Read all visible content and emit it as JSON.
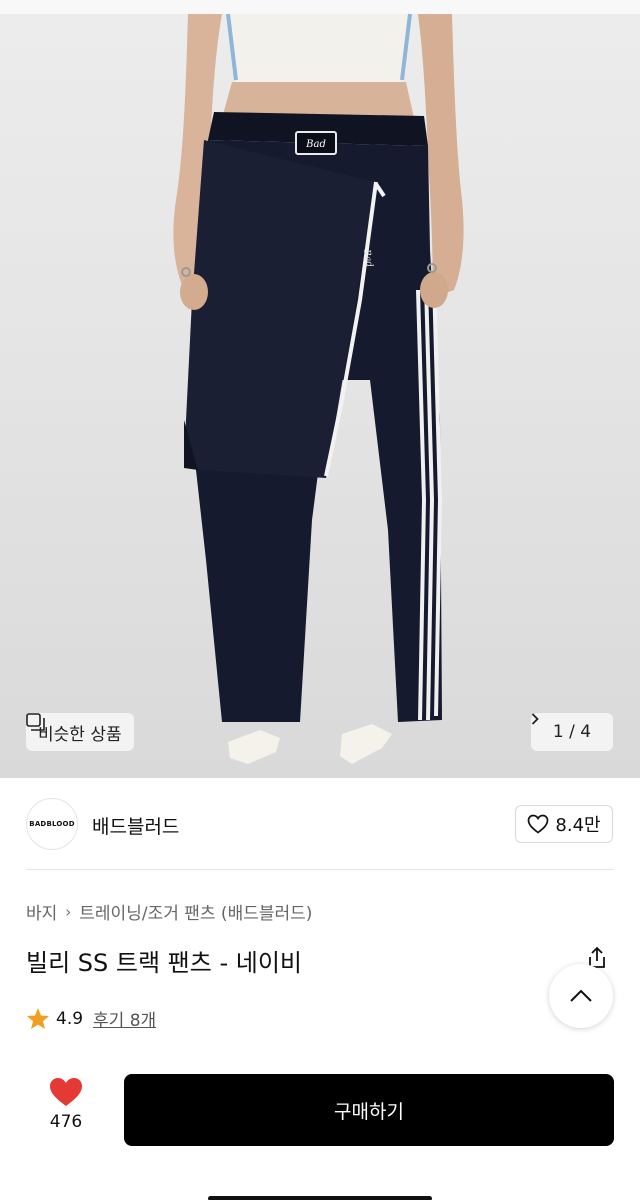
{
  "product_image": {
    "similar_button_label": "비슷한 상품",
    "pager_text": "1 / 4",
    "icons": [
      "similar-items-icon",
      "chevron-right-icon"
    ]
  },
  "brand": {
    "logo_text": "BADBLOOD",
    "name": "배드블러드",
    "likes": "8.4만"
  },
  "breadcrumb": {
    "items": [
      "바지",
      "트레이닝/조거 팬츠 (배드블러드)"
    ],
    "separator": "›"
  },
  "product": {
    "title": "빌리 SS 트랙 팬츠 - 네이비",
    "rating": "4.9",
    "review_link": "후기 8개"
  },
  "bottom_bar": {
    "wish_count": "476",
    "buy_label": "구매하기"
  },
  "colors": {
    "heart": "#e53935",
    "star": "#f0a020",
    "buy_button_bg": "#000000",
    "pants_navy": "#151a2e"
  }
}
